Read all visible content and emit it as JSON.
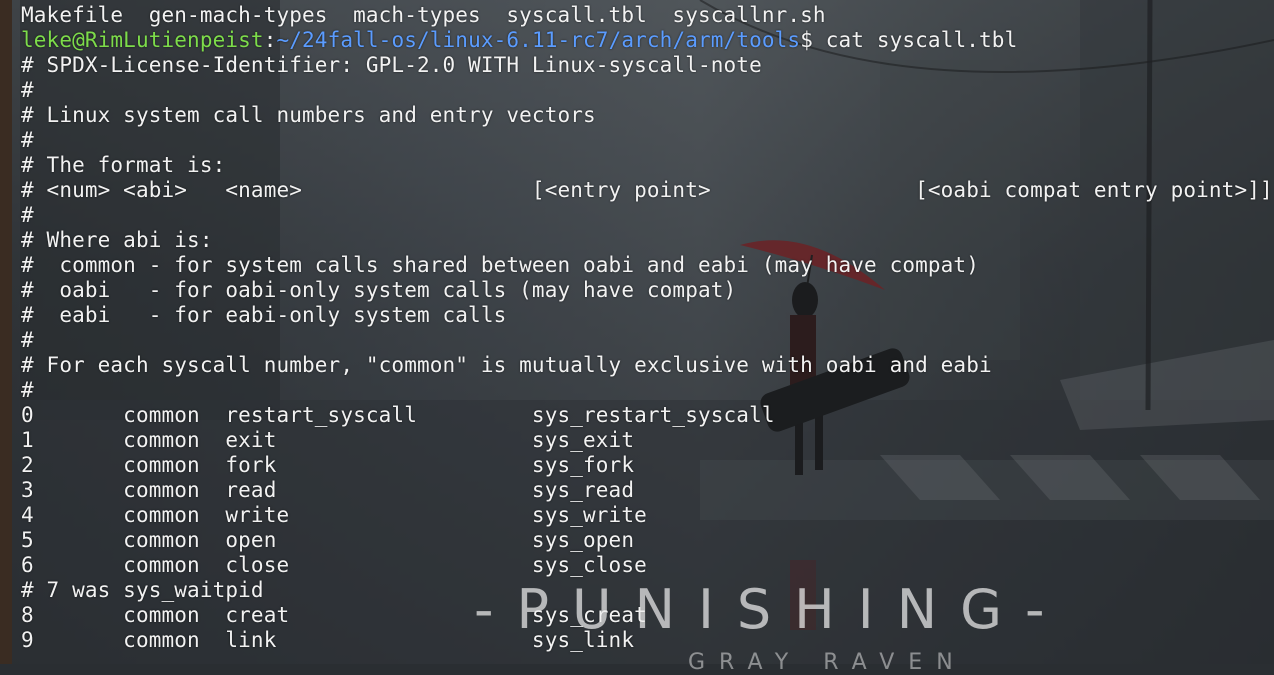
{
  "terminal": {
    "listing": "Makefile  gen-mach-types  mach-types  syscall.tbl  syscallnr.sh",
    "prompt": {
      "user_host": "leke@RimLutienpeist",
      "separator": ":",
      "path": "~/24fall-os/linux-6.11-rc7/arch/arm/tools",
      "symbol": "$",
      "command": " cat syscall.tbl"
    },
    "output": [
      "# SPDX-License-Identifier: GPL-2.0 WITH Linux-syscall-note",
      "#",
      "# Linux system call numbers and entry vectors",
      "#",
      "# The format is:",
      "# <num> <abi>   <name>                  [<entry point>                [<oabi compat entry point>]]",
      "#",
      "# Where abi is:",
      "#  common - for system calls shared between oabi and eabi (may have compat)",
      "#  oabi   - for oabi-only system calls (may have compat)",
      "#  eabi   - for eabi-only system calls",
      "#",
      "# For each syscall number, \"common\" is mutually exclusive with oabi and eabi",
      "#",
      "0       common  restart_syscall         sys_restart_syscall",
      "1       common  exit                    sys_exit",
      "2       common  fork                    sys_fork",
      "3       common  read                    sys_read",
      "4       common  write                   sys_write",
      "5       common  open                    sys_open",
      "6       common  close                   sys_close",
      "# 7 was sys_waitpid",
      "8       common  creat                   sys_creat",
      "9       common  link                    sys_link"
    ]
  },
  "wallpaper": {
    "brand": "-PUNISHING-",
    "brand_sub": "GRAY RAVEN"
  },
  "colors": {
    "text": "#f2f2f2",
    "prompt_user": "#7ddc4a",
    "prompt_path": "#5b9cff"
  }
}
